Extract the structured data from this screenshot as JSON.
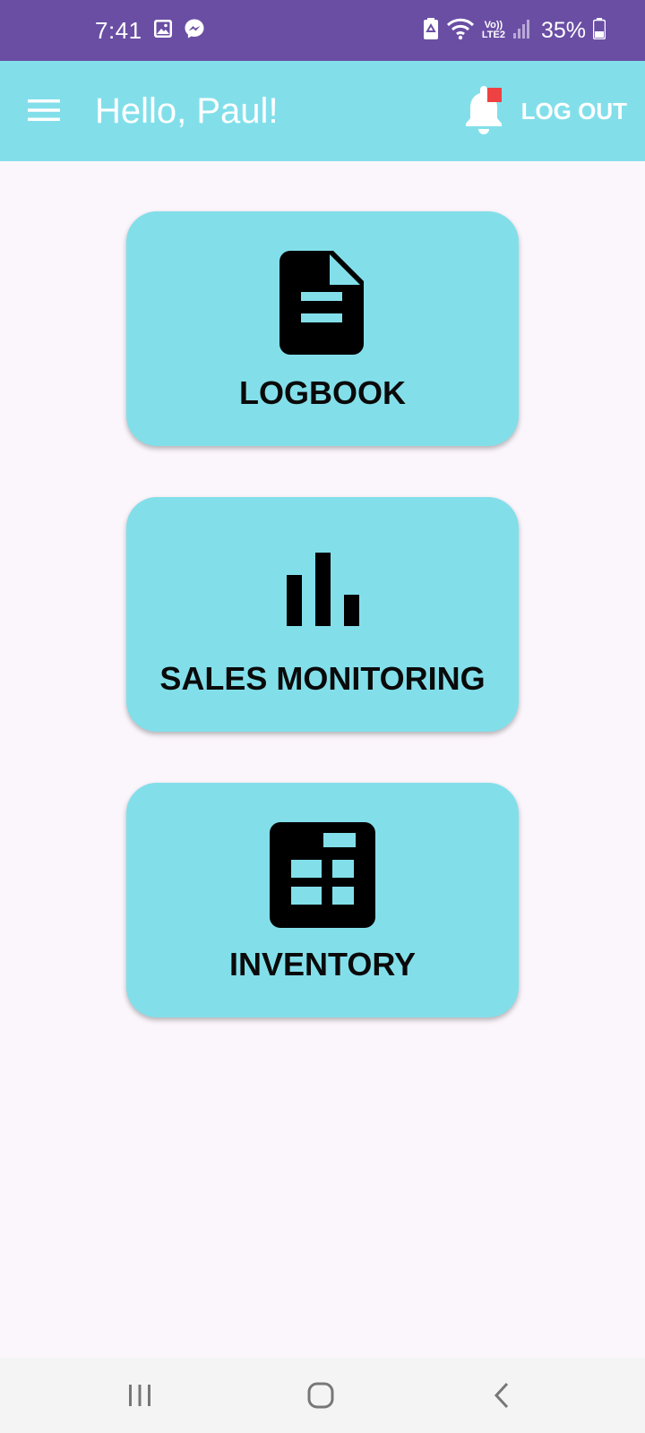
{
  "status_bar": {
    "time": "7:41",
    "network_label_top": "Vo))",
    "network_label_bottom": "LTE2",
    "battery": "35%"
  },
  "app_bar": {
    "title": "Hello, Paul!",
    "logout_label": "LOG OUT"
  },
  "menu": [
    {
      "label": "LOGBOOK",
      "icon": "document-icon"
    },
    {
      "label": "SALES MONITORING",
      "icon": "bar-chart-icon"
    },
    {
      "label": "INVENTORY",
      "icon": "table-icon"
    }
  ],
  "colors": {
    "status_bar": "#6a4ea4",
    "primary": "#82dfea",
    "background": "#fbf6fc",
    "notification_badge": "#ee4242"
  }
}
